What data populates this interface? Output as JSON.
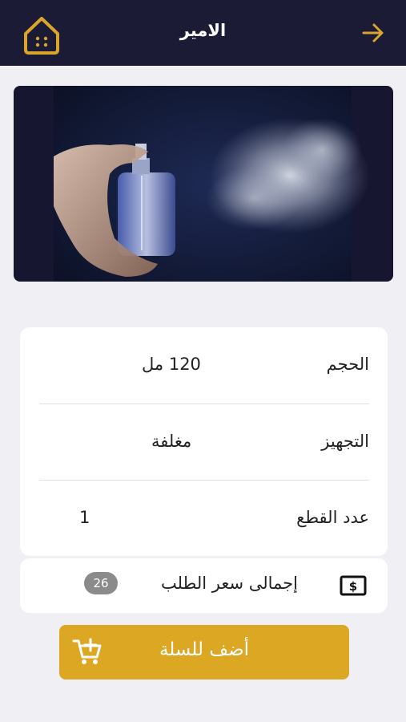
{
  "header": {
    "title": "الامير",
    "home_icon": "home-icon",
    "back_icon": "arrow-right-icon",
    "accent": "#d9a52b",
    "background": "#1b1b36"
  },
  "hero": {
    "image": "perfume-spray-photo"
  },
  "details": {
    "rows": [
      {
        "label": "الحجم",
        "value": "120 مل"
      },
      {
        "label": "التجهيز",
        "value": "مغلفة"
      },
      {
        "label": "عدد القطع",
        "value": "1"
      }
    ]
  },
  "total": {
    "label": "إجمالى سعر الطلب",
    "price": "26",
    "icon": "money-icon"
  },
  "cart_button": {
    "label": "أضف للسلة",
    "icon": "add-to-cart-icon",
    "color": "#dca823"
  }
}
